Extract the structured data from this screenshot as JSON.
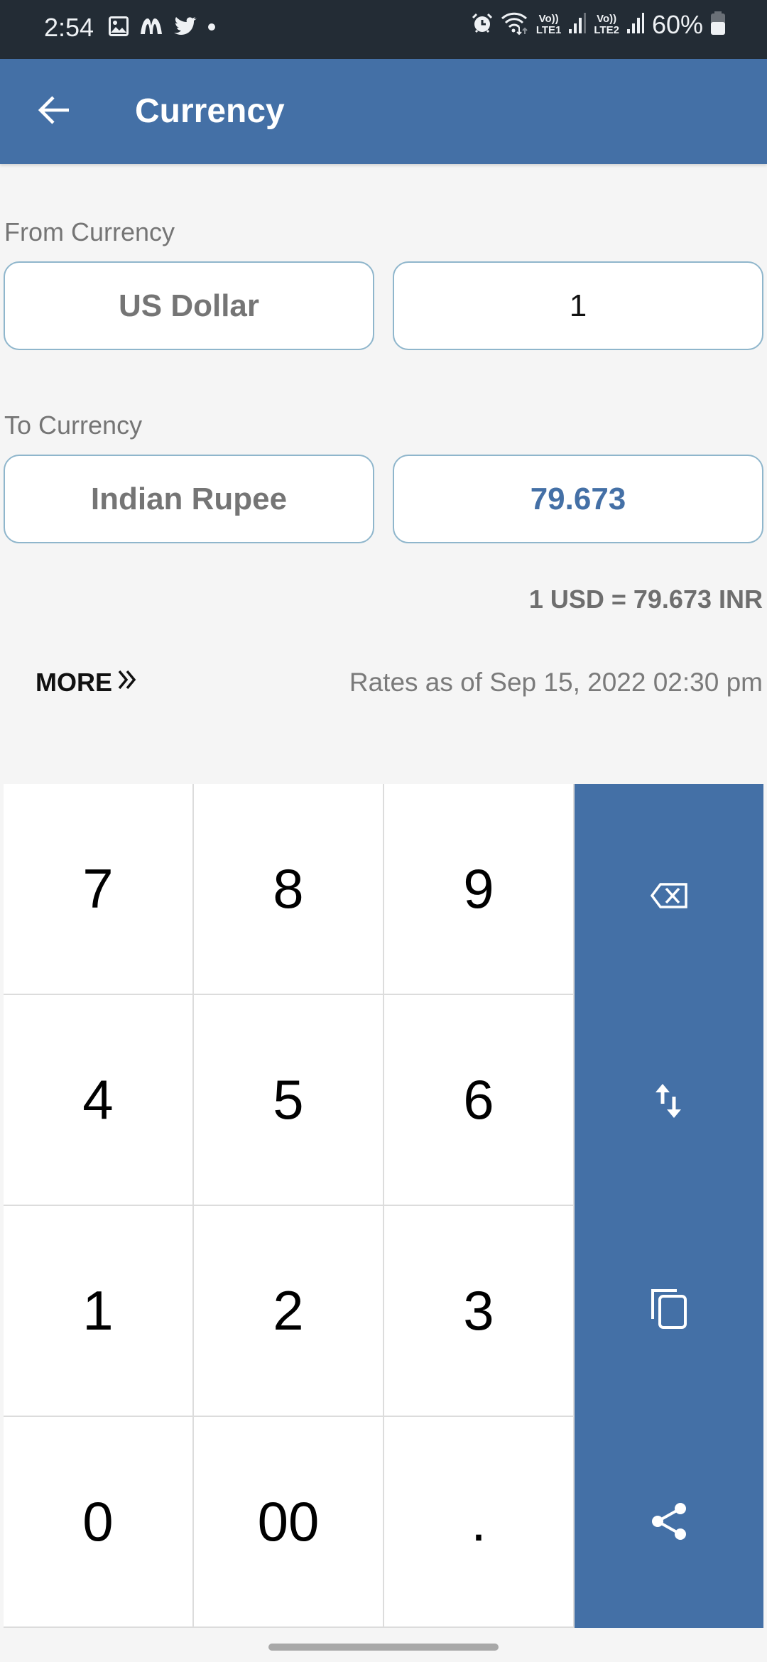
{
  "status_bar": {
    "time": "2:54",
    "left_icons": [
      "gallery-icon",
      "m-app-icon",
      "twitter-icon",
      "dot-icon"
    ],
    "right_icons": [
      "alarm-icon",
      "wifi-icon",
      "signal-sim1-icon",
      "signal-sim2-icon",
      "battery-icon"
    ],
    "sim1_label_top": "Vo))",
    "sim1_label_bottom": "LTE1",
    "sim2_label_top": "Vo))",
    "sim2_label_bottom": "LTE2",
    "battery_percent": "60%"
  },
  "app_bar": {
    "title": "Currency",
    "back_icon": "arrow-left-icon"
  },
  "from": {
    "label": "From Currency",
    "currency": "US Dollar",
    "amount": "1"
  },
  "to": {
    "label": "To Currency",
    "currency": "Indian Rupee",
    "amount": "79.673"
  },
  "rate_summary": "1 USD = 79.673 INR",
  "more_label": "MORE",
  "rates_as_of": "Rates as of  Sep 15, 2022 02:30 pm",
  "keypad": {
    "keys": [
      [
        "7",
        "8",
        "9"
      ],
      [
        "4",
        "5",
        "6"
      ],
      [
        "1",
        "2",
        "3"
      ],
      [
        "0",
        "00",
        "."
      ]
    ],
    "actions": [
      "backspace-icon",
      "swap-icon",
      "copy-icon",
      "share-icon"
    ]
  },
  "colors": {
    "primary": "#4470a6",
    "status_bar": "#232c35",
    "background": "#f5f5f5",
    "result_text": "#4470a6",
    "field_border": "#8fb6cc"
  }
}
